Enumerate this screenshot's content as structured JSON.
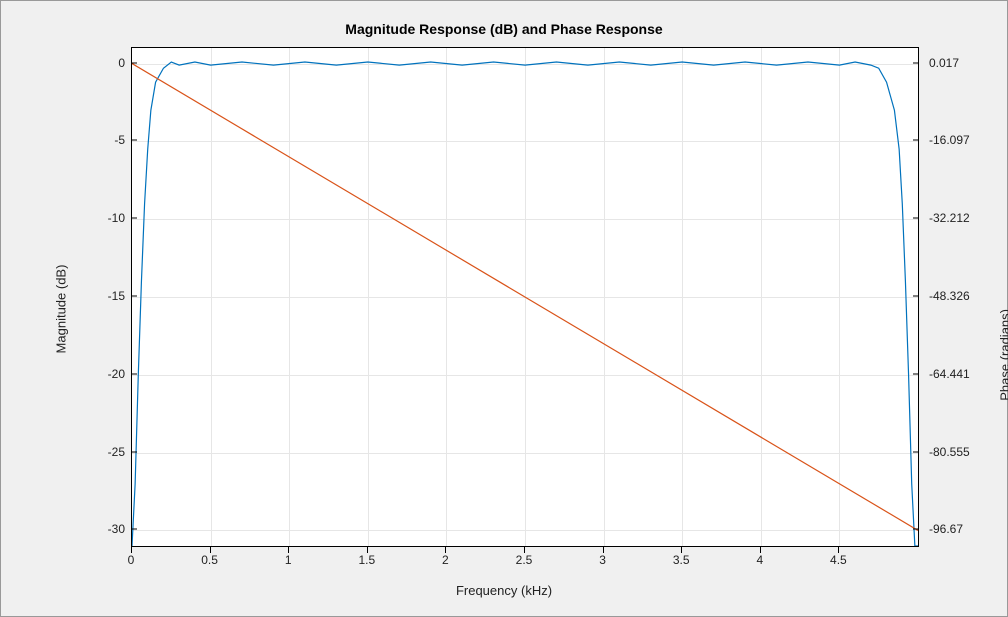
{
  "chart_data": {
    "type": "line",
    "title": "Magnitude Response (dB) and Phase Response",
    "xlabel": "Frequency (kHz)",
    "ylabel_left": "Magnitude (dB)",
    "ylabel_right": "Phase (radians)",
    "xlim": [
      0,
      5
    ],
    "ylim_left": [
      -31,
      1
    ],
    "ylim_right": [
      -99.893,
      3.24
    ],
    "x_ticks": [
      0,
      0.5,
      1,
      1.5,
      2,
      2.5,
      3,
      3.5,
      4,
      4.5
    ],
    "y_ticks_left": [
      0,
      -5,
      -10,
      -15,
      -20,
      -25,
      -30
    ],
    "y_ticks_right": [
      0.017,
      -16.097,
      -32.212,
      -48.326,
      -64.441,
      -80.555,
      -96.67
    ],
    "series": [
      {
        "name": "Magnitude",
        "axis": "left",
        "color": "#0072bd",
        "x": [
          0,
          0.02,
          0.04,
          0.06,
          0.08,
          0.1,
          0.12,
          0.15,
          0.2,
          0.25,
          0.3,
          0.4,
          0.5,
          0.7,
          0.9,
          1.1,
          1.3,
          1.5,
          1.7,
          1.9,
          2.1,
          2.3,
          2.5,
          2.7,
          2.9,
          3.1,
          3.3,
          3.5,
          3.7,
          3.9,
          4.1,
          4.3,
          4.5,
          4.6,
          4.7,
          4.75,
          4.8,
          4.85,
          4.88,
          4.9,
          4.92,
          4.94,
          4.96,
          4.98,
          5.0
        ],
        "y": [
          -31,
          -27,
          -20,
          -14,
          -9,
          -5.5,
          -3,
          -1.2,
          -0.3,
          0.1,
          -0.1,
          0.1,
          -0.1,
          0.1,
          -0.1,
          0.1,
          -0.1,
          0.1,
          -0.1,
          0.1,
          -0.1,
          0.1,
          -0.1,
          0.1,
          -0.1,
          0.1,
          -0.1,
          0.1,
          -0.1,
          0.1,
          -0.1,
          0.1,
          -0.1,
          0.1,
          -0.1,
          -0.3,
          -1.2,
          -3,
          -5.5,
          -9,
          -14,
          -20,
          -27,
          -31,
          -31
        ]
      },
      {
        "name": "Phase",
        "axis": "right",
        "color": "#d95319",
        "x": [
          0,
          5
        ],
        "y": [
          0.017,
          -96.67
        ]
      }
    ]
  }
}
